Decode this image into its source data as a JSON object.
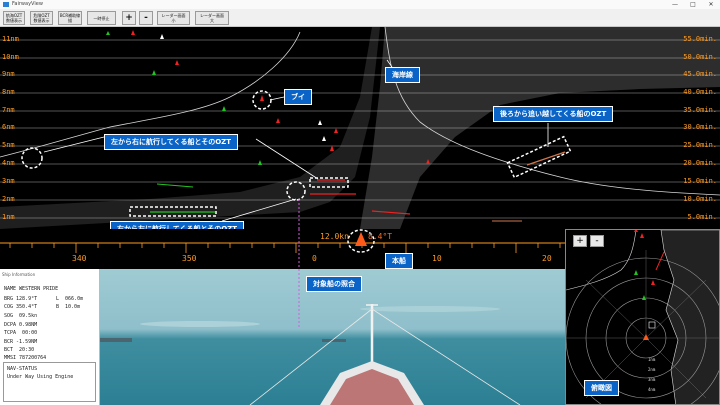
{
  "window": {
    "title": "FairwayView"
  },
  "toolbar": {
    "buttons": [
      {
        "label": "航海OZT\n数値表示"
      },
      {
        "label": "危険OZT\n数値表示"
      },
      {
        "label": "BCR補助線\n描"
      },
      {
        "label": "一時停止"
      },
      {
        "label": "+"
      },
      {
        "label": "-"
      },
      {
        "label": "レーダー画面\n小"
      },
      {
        "label": "レーダー画面\n大"
      }
    ]
  },
  "radar": {
    "range_left": [
      "11nm",
      "10nm",
      "9nm",
      "8nm",
      "7nm",
      "6nm",
      "5nm",
      "4nm",
      "3nm",
      "2nm",
      "1nm"
    ],
    "range_right": [
      "55.0min.",
      "50.0min.",
      "45.0min.",
      "40.0min.",
      "35.0min.",
      "30.0min.",
      "25.0min.",
      "20.0min.",
      "15.0min.",
      "10.0min.",
      "5.0min."
    ]
  },
  "compass": {
    "headings": [
      "340",
      "350",
      "0",
      "10",
      "20"
    ],
    "speed_readout": "12.0kn",
    "course_readout": "8.4°T"
  },
  "ship_info": {
    "header": "Ship Information",
    "name": "NAME WESTERN PRIDE",
    "brg": "BRG 128.9°T",
    "l": "L  066.0m",
    "cog": "COG 350.4°T",
    "b": "B  10.0m",
    "sog": "SOG  09.5kn",
    "dcpa": "DCPA 0.98NM",
    "tcpa": "TCPA  00:00",
    "bcr": "BCR -1.59NM",
    "bct": "BCT  20:30",
    "mmsi": "MMSI 787200764",
    "nav_status_label": "NAV-STATUS",
    "nav_status_value": "Under Way Using Engine"
  },
  "overview": {
    "zoom_in": "+",
    "zoom_out": "-",
    "ring_labels": [
      "1nm",
      "2nm",
      "3nm",
      "4nm"
    ]
  },
  "annotations": {
    "coastline": "海岸線",
    "buoy": "ブイ",
    "overtaking": "後ろから追い越してくる船のOZT",
    "left_to_right": "左から右に航行してくる船とそのOZT",
    "right_to_left": "右から左に航行してくる船とそのOZT",
    "own_ship": "本船",
    "target_match": "対象船の照合",
    "bird_view": "俯瞰図"
  }
}
